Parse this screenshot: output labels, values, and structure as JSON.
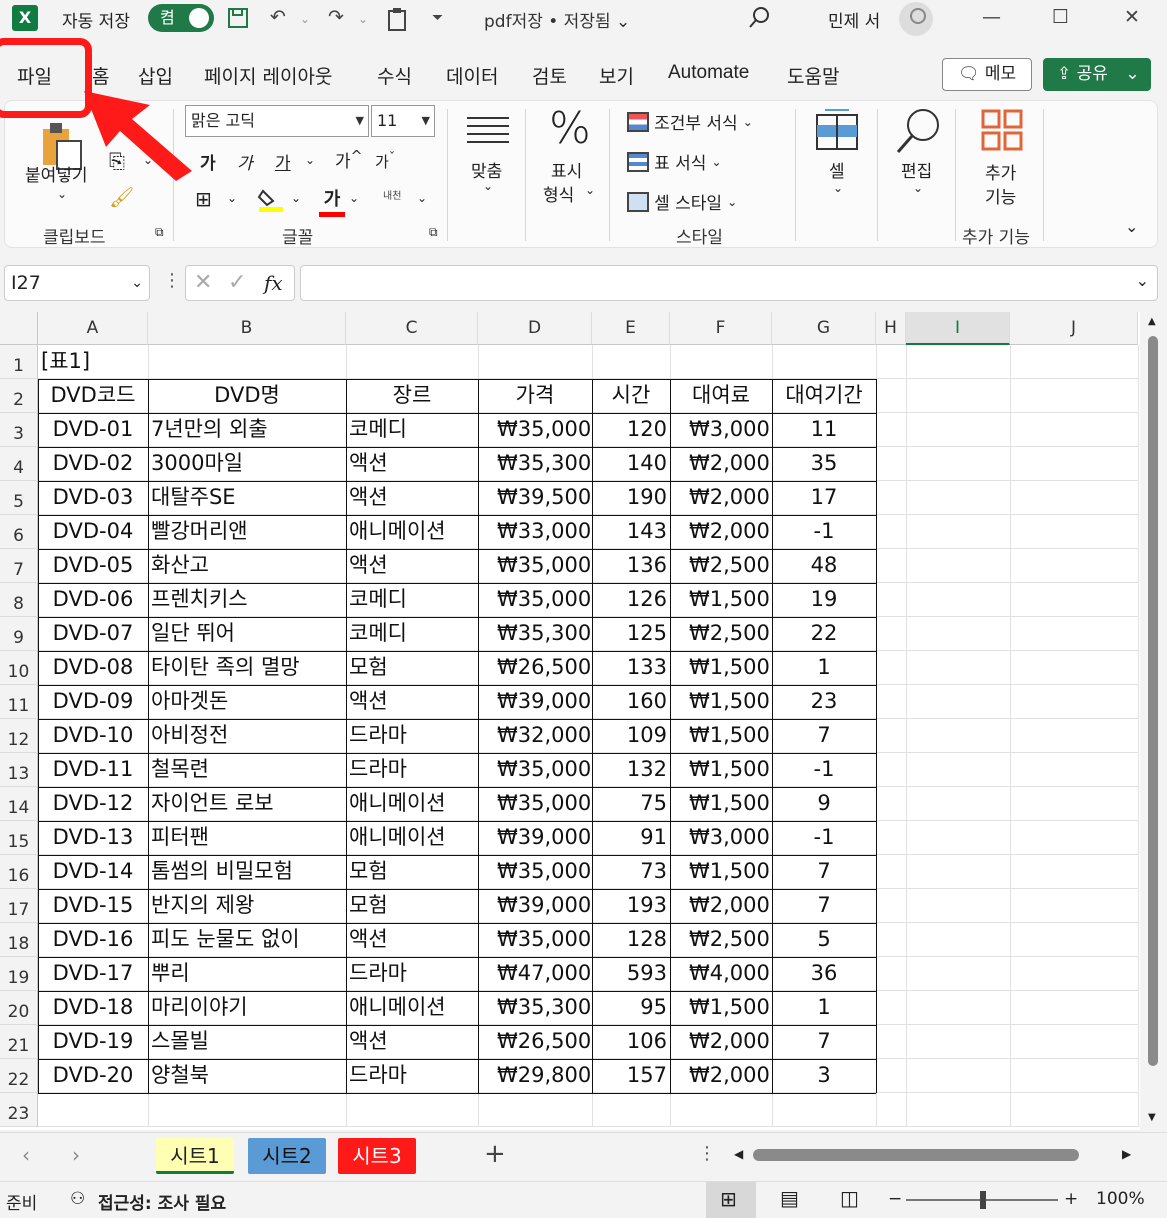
{
  "titlebar": {
    "autosave_label": "자동 저장",
    "autosave_state": "켬",
    "doc_title": "pdf저장 • 저장됨 ",
    "user_name": "민제 서"
  },
  "tabs": [
    "파일",
    "홈",
    "삽입",
    "페이지 레이아웃",
    "수식",
    "데이터",
    "검토",
    "보기",
    "Automate",
    "도움말"
  ],
  "memo_label": "메모",
  "share_label": "공유",
  "ribbon": {
    "paste": "붙여넣기",
    "clipboard": "클립보드",
    "font_name": "맑은 고딕",
    "font_size": "11",
    "bold": "가",
    "italic": "가",
    "underline": "가",
    "grow": "가",
    "shrink": "가",
    "font_group": "글꼴",
    "align": "맞춤",
    "number_1": "표시",
    "number_2": "형식",
    "cond_format": "조건부 서식",
    "table_format": "표 서식",
    "cell_style": "셀 스타일",
    "style_group": "스타일",
    "cells": "셀",
    "editing": "편집",
    "addin_1": "추가",
    "addin_2": "기능",
    "addin_group": "추가 기능",
    "font_color_glyph": "가",
    "phonetic": "내천"
  },
  "namebox": "I27",
  "fx": "fx",
  "columns": [
    "A",
    "B",
    "C",
    "D",
    "E",
    "F",
    "G",
    "H",
    "I",
    "J"
  ],
  "rows": [
    "1",
    "2",
    "3",
    "4",
    "5",
    "6",
    "7",
    "8",
    "9",
    "10",
    "11",
    "12",
    "13",
    "14",
    "15",
    "16",
    "17",
    "18",
    "19",
    "20",
    "21",
    "22",
    "23"
  ],
  "cell_a1": "[표1]",
  "headers": [
    "DVD코드",
    "DVD명",
    "장르",
    "가격",
    "시간",
    "대여료",
    "대여기간"
  ],
  "currency": "₩",
  "table": [
    [
      "DVD-01",
      "7년만의 외출",
      "코메디",
      "35,000",
      "120",
      "3,000",
      "11"
    ],
    [
      "DVD-02",
      "3000마일",
      "액션",
      "35,300",
      "140",
      "2,000",
      "35"
    ],
    [
      "DVD-03",
      "대탈주SE",
      "액션",
      "39,500",
      "190",
      "2,000",
      "17"
    ],
    [
      "DVD-04",
      "빨강머리앤",
      "애니메이션",
      "33,000",
      "143",
      "2,000",
      "-1"
    ],
    [
      "DVD-05",
      "화산고",
      "액션",
      "35,000",
      "136",
      "2,500",
      "48"
    ],
    [
      "DVD-06",
      "프렌치키스",
      "코메디",
      "35,000",
      "126",
      "1,500",
      "19"
    ],
    [
      "DVD-07",
      "일단 뛰어",
      "코메디",
      "35,300",
      "125",
      "2,500",
      "22"
    ],
    [
      "DVD-08",
      "타이탄 족의 멸망",
      "모험",
      "26,500",
      "133",
      "1,500",
      "1"
    ],
    [
      "DVD-09",
      "아마겟돈",
      "액션",
      "39,000",
      "160",
      "1,500",
      "23"
    ],
    [
      "DVD-10",
      "아비정전",
      "드라마",
      "32,000",
      "109",
      "1,500",
      "7"
    ],
    [
      "DVD-11",
      "철목련",
      "드라마",
      "35,000",
      "132",
      "1,500",
      "-1"
    ],
    [
      "DVD-12",
      "자이언트 로보",
      "애니메이션",
      "35,000",
      "75",
      "1,500",
      "9"
    ],
    [
      "DVD-13",
      "피터팬",
      "애니메이션",
      "39,000",
      "91",
      "3,000",
      "-1"
    ],
    [
      "DVD-14",
      "톰썸의 비밀모험",
      "모험",
      "35,000",
      "73",
      "1,500",
      "7"
    ],
    [
      "DVD-15",
      "반지의 제왕",
      "모험",
      "39,000",
      "193",
      "2,000",
      "7"
    ],
    [
      "DVD-16",
      "피도 눈물도 없이",
      "액션",
      "35,000",
      "128",
      "2,500",
      "5"
    ],
    [
      "DVD-17",
      "뿌리",
      "드라마",
      "47,000",
      "593",
      "4,000",
      "36"
    ],
    [
      "DVD-18",
      "마리이야기",
      "애니메이션",
      "35,300",
      "95",
      "1,500",
      "1"
    ],
    [
      "DVD-19",
      "스몰빌",
      "액션",
      "26,500",
      "106",
      "2,000",
      "7"
    ],
    [
      "DVD-20",
      "양철북",
      "드라마",
      "29,800",
      "157",
      "2,000",
      "3"
    ]
  ],
  "sheets": [
    {
      "label": "시트1",
      "bg": "#ffffb3",
      "fg": "#222222",
      "active": true
    },
    {
      "label": "시트2",
      "bg": "#5b9bd5",
      "fg": "#111111",
      "active": false
    },
    {
      "label": "시트3",
      "bg": "#ff1a1a",
      "fg": "#ffffff",
      "active": false
    }
  ],
  "status": {
    "ready": "준비",
    "accessibility": "접근성: 조사 필요",
    "zoom": "100%"
  },
  "colors": {
    "excel_green": "#107c41",
    "accent_red": "#ff1a1a"
  }
}
